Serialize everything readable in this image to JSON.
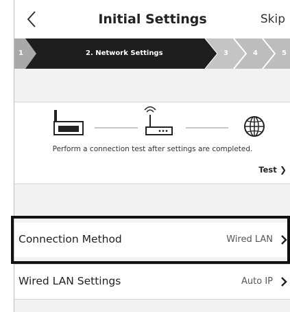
{
  "header": {
    "title": "Initial Settings",
    "skip_label": "Skip"
  },
  "stepbar": {
    "steps": [
      {
        "label": "1",
        "state": "done"
      },
      {
        "label": "2. Network Settings",
        "state": "current"
      },
      {
        "label": "3",
        "state": "upcoming"
      },
      {
        "label": "4",
        "state": "upcoming"
      },
      {
        "label": "5",
        "state": "upcoming"
      }
    ]
  },
  "diagram": {
    "icons": [
      "printer-icon",
      "router-icon",
      "globe-icon"
    ],
    "message": "Perform a connection test after settings are completed.",
    "test_label": "Test"
  },
  "settings": [
    {
      "label": "Connection Method",
      "value": "Wired LAN",
      "highlighted": true
    },
    {
      "label": "Wired LAN Settings",
      "value": "Auto IP",
      "highlighted": false
    }
  ],
  "colors": {
    "stepbar_dark": "#1e1e1e",
    "stepbar_light": "#bdbdbd",
    "background": "#f2f2f2",
    "highlight_border": "#111111"
  }
}
